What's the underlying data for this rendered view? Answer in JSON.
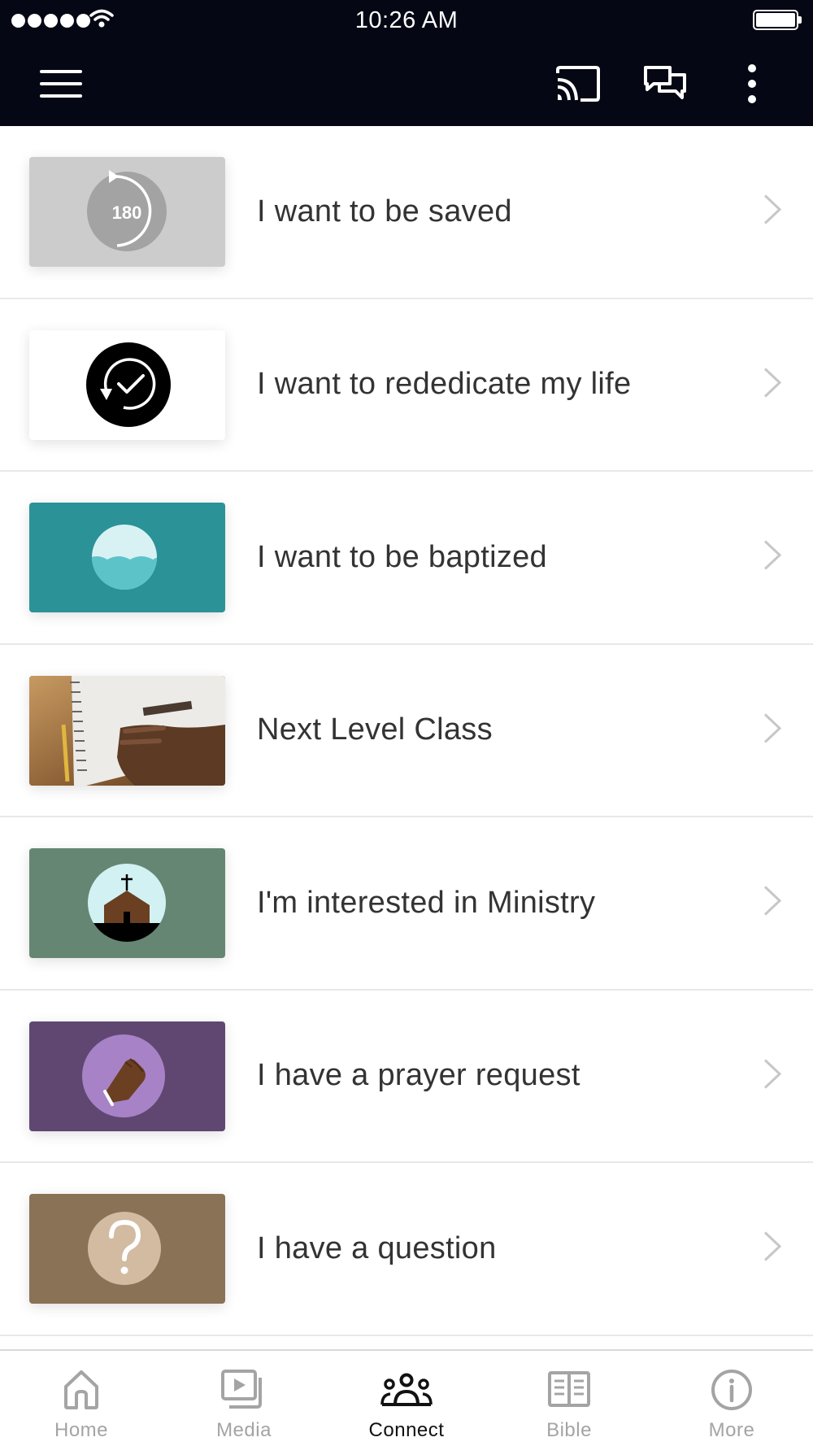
{
  "status_bar": {
    "time": "10:26 AM"
  },
  "nav_bar": {
    "icons": [
      "hamburger-menu-icon",
      "cast-icon",
      "chat-icon",
      "more-vertical-icon"
    ]
  },
  "list": {
    "items": [
      {
        "label": "I want to be saved",
        "thumb_icon": "180-turn-icon",
        "thumb_bg": "#cccccc"
      },
      {
        "label": "I want to rededicate my life",
        "thumb_icon": "rededicate-check-icon",
        "thumb_bg": "#ffffff"
      },
      {
        "label": "I want to be baptized",
        "thumb_icon": "water-baptism-icon",
        "thumb_bg": "#2b9298"
      },
      {
        "label": "Next Level Class",
        "thumb_icon": "notebook-photo",
        "thumb_bg": "#a47a4b"
      },
      {
        "label": "I'm interested in Ministry",
        "thumb_icon": "church-icon",
        "thumb_bg": "#658673"
      },
      {
        "label": "I have a prayer request",
        "thumb_icon": "praying-hands-icon",
        "thumb_bg": "#604771"
      },
      {
        "label": "I have a question",
        "thumb_icon": "question-mark-icon",
        "thumb_bg": "#8a7257"
      }
    ]
  },
  "tab_bar": {
    "active": "Connect",
    "tabs": [
      {
        "label": "Home",
        "icon": "home-icon"
      },
      {
        "label": "Media",
        "icon": "media-icon"
      },
      {
        "label": "Connect",
        "icon": "people-icon"
      },
      {
        "label": "Bible",
        "icon": "book-icon"
      },
      {
        "label": "More",
        "icon": "info-icon"
      }
    ]
  },
  "colors": {
    "header_bg": "#050814",
    "text": "#333333",
    "tab_inactive": "#a4a4a4",
    "tab_active": "#111111",
    "divider": "#e8e8e8"
  }
}
